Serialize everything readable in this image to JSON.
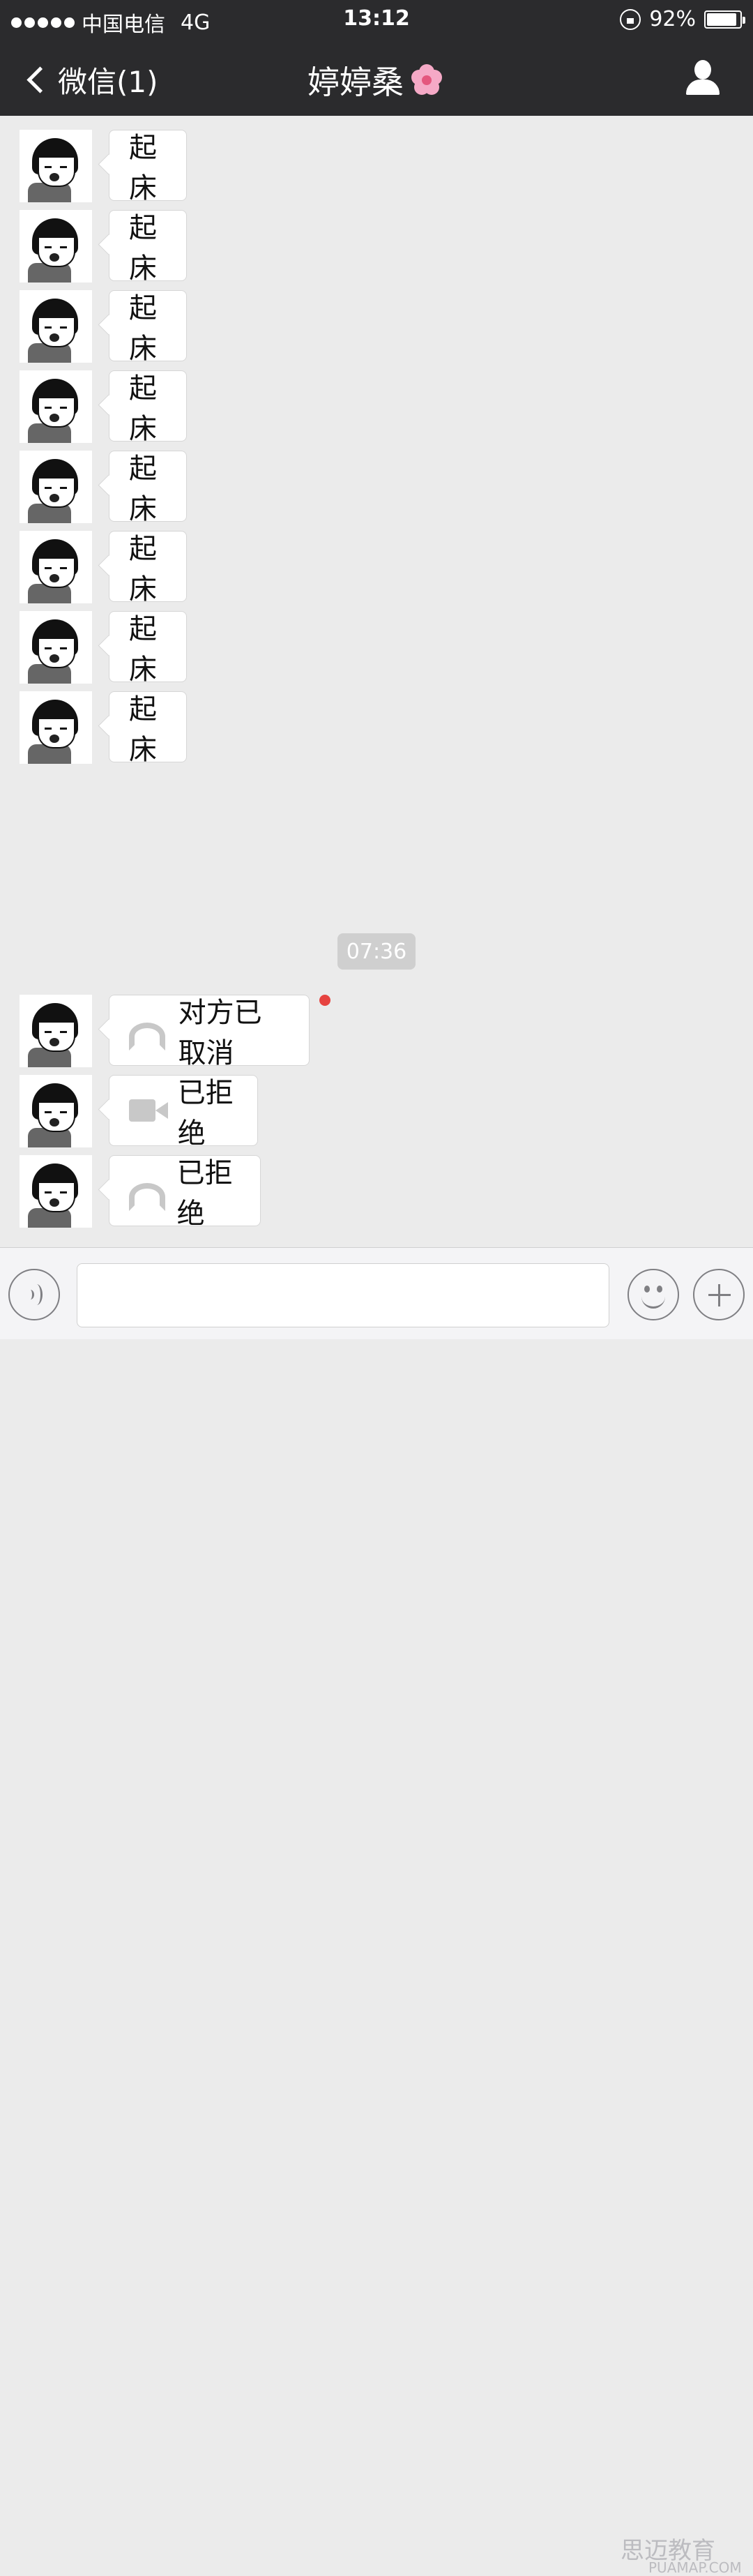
{
  "status_bar": {
    "carrier": "中国电信",
    "network": "4G",
    "time": "13:12",
    "battery": "92%",
    "battery_level": 0.92
  },
  "nav": {
    "back_label": "微信(1)",
    "title": "婷婷桑",
    "title_icon": "cherry-blossom-icon"
  },
  "messages": [
    {
      "type": "text",
      "text": "起床"
    },
    {
      "type": "text",
      "text": "起床"
    },
    {
      "type": "text",
      "text": "起床"
    },
    {
      "type": "text",
      "text": "起床"
    },
    {
      "type": "text",
      "text": "起床"
    },
    {
      "type": "text",
      "text": "起床"
    },
    {
      "type": "text",
      "text": "起床"
    },
    {
      "type": "text",
      "text": "起床"
    }
  ],
  "timestamp": "07:36",
  "call_messages": [
    {
      "icon": "phone-icon",
      "text": "对方已取消",
      "unread": true
    },
    {
      "icon": "video-icon",
      "text": "已拒绝",
      "unread": false
    },
    {
      "icon": "phone-icon",
      "text": "已拒绝",
      "unread": false
    }
  ],
  "input_bar": {
    "voice_icon": "voice-icon",
    "emoji_icon": "emoji-icon",
    "plus_icon": "plus-icon"
  },
  "watermark": {
    "text": "思迈教育",
    "sub": "PUAMAP.COM"
  },
  "colors": {
    "nav_bg": "#2b2b2d",
    "chat_bg": "#ebebeb",
    "unread_dot": "#e64340"
  }
}
